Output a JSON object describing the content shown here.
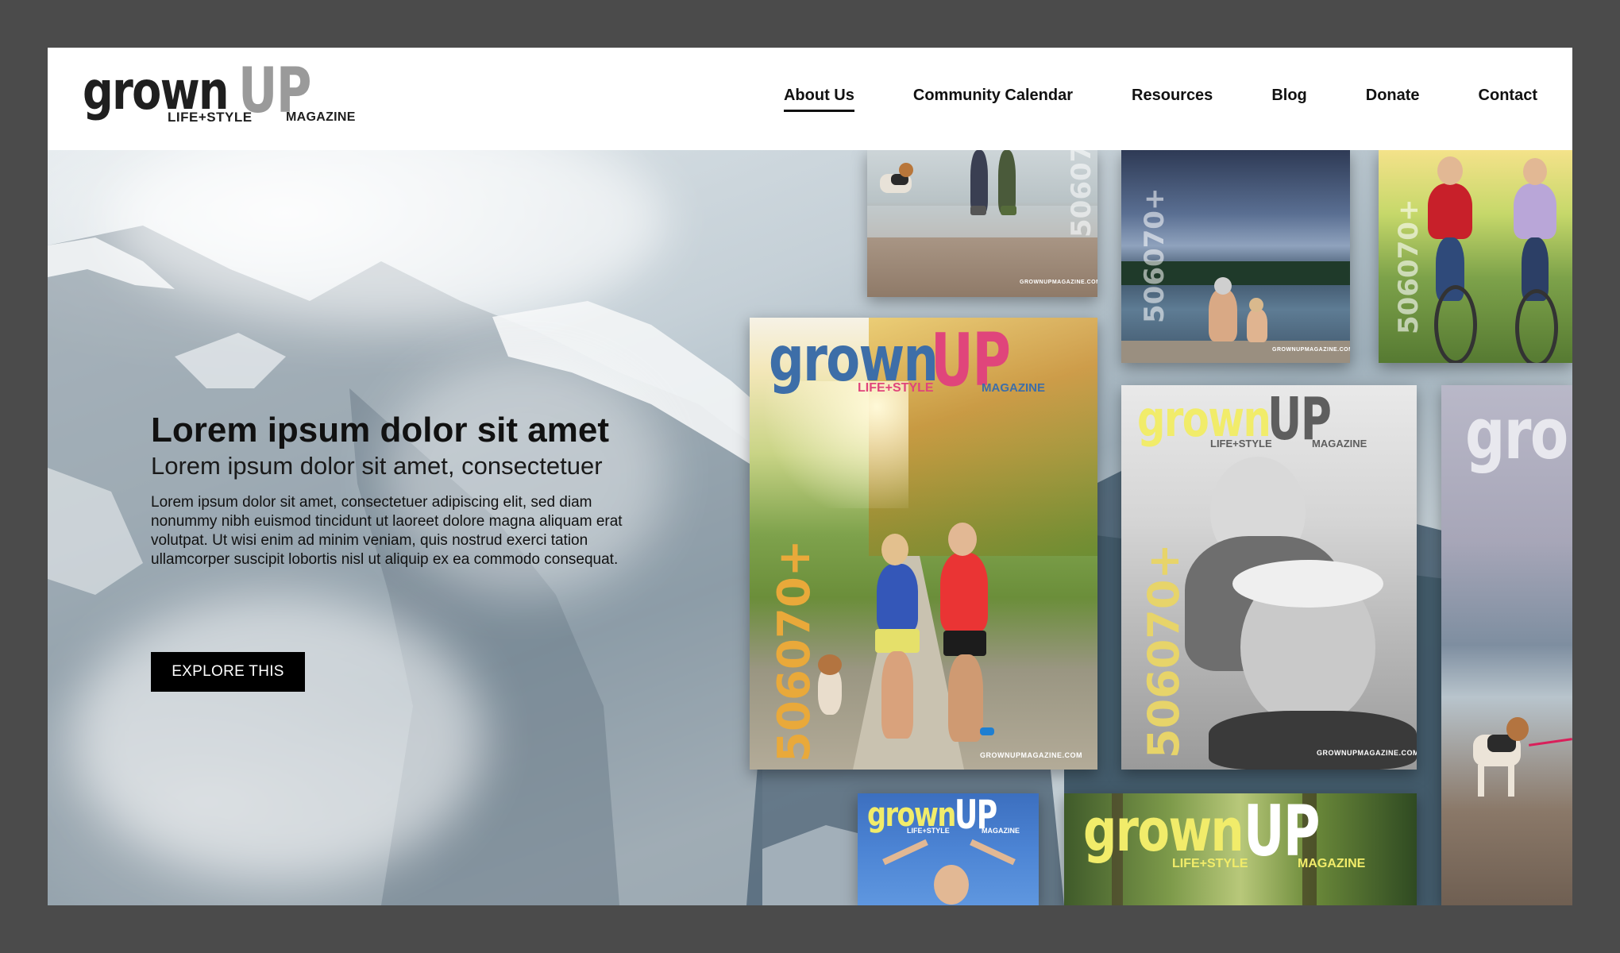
{
  "brand": {
    "wordmark_left": "grown",
    "wordmark_right": "UP",
    "tagline": "LIFE+STYLE",
    "suffix": "MAGAZINE"
  },
  "nav": {
    "items": [
      {
        "label": "About Us",
        "active": true
      },
      {
        "label": "Community Calendar",
        "active": false
      },
      {
        "label": "Resources",
        "active": false
      },
      {
        "label": "Blog",
        "active": false
      },
      {
        "label": "Donate",
        "active": false
      },
      {
        "label": "Contact",
        "active": false
      }
    ]
  },
  "hero": {
    "title": "Lorem ipsum dolor sit amet",
    "subtitle": "Lorem ipsum dolor sit amet, consectetuer",
    "body": "Lorem ipsum dolor sit amet, consectetuer adipiscing elit, sed diam nonummy nibh euismod tincidunt ut laoreet dolore magna aliquam erat volutpat. Ut wisi enim ad minim veniam, quis nostrud exerci tation ullamcorper suscipit lobortis nisl ut aliquip ex ea commodo consequat.",
    "cta_label": "EXPLORE THIS"
  },
  "covers": {
    "site": "GROWNUPMAGAZINE.COM",
    "ages": "506070+",
    "main_grown": "grown",
    "main_up": "UP",
    "main_tagline": "LIFE+STYLE",
    "main_magazine": "MAGAZINE",
    "partial_text": "gro"
  },
  "colors": {
    "accent_blue": "#3d6ea8",
    "accent_pink": "#e0457b",
    "accent_yellow": "#f1ec6a",
    "nav_text": "#111111"
  }
}
